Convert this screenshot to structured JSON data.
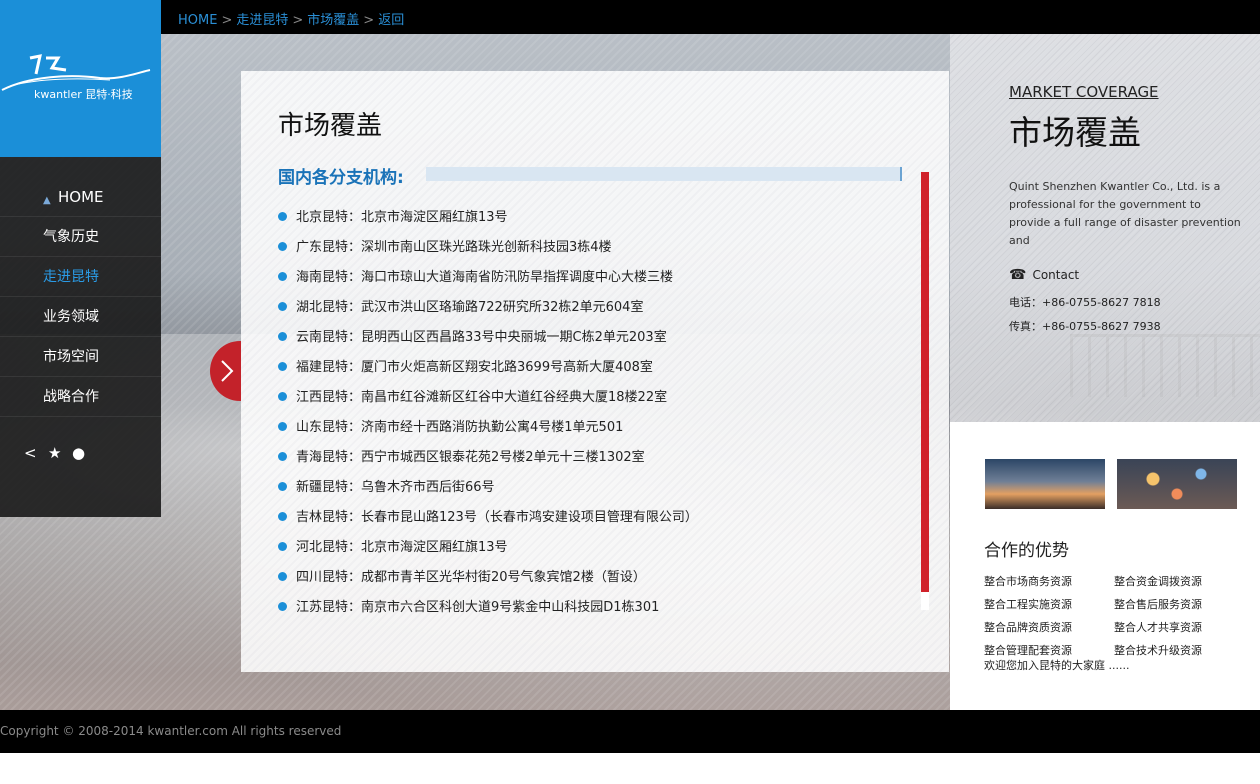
{
  "breadcrumb": {
    "items": [
      "HOME",
      "走进昆特",
      "市场覆盖",
      "返回"
    ],
    "separator": ">"
  },
  "logo": {
    "text": "kwantler 昆特·科技"
  },
  "sidebar": {
    "items": [
      {
        "label": "HOME",
        "icon": "home-icon"
      },
      {
        "label": "气象历史"
      },
      {
        "label": "走进昆特",
        "active": true
      },
      {
        "label": "业务领域"
      },
      {
        "label": "市场空间"
      },
      {
        "label": "战略合作"
      }
    ],
    "social_icons": [
      "share-icon",
      "star-icon",
      "wechat-icon"
    ]
  },
  "main": {
    "title": "市场覆盖",
    "section_heading": "国内各分支机构:",
    "branches": [
      "北京昆特：北京市海淀区厢红旗13号",
      "广东昆特：深圳市南山区珠光路珠光创新科技园3栋4楼",
      "海南昆特：海口市琼山大道海南省防汛防旱指挥调度中心大楼三楼",
      "湖北昆特：武汉市洪山区珞瑜路722研究所32栋2单元604室",
      "云南昆特：昆明西山区西昌路33号中央丽城一期C栋2单元203室",
      "福建昆特：厦门市火炬高新区翔安北路3699号高新大厦408室",
      "江西昆特：南昌市红谷滩新区红谷中大道红谷经典大厦18楼22室",
      "山东昆特：济南市经十西路消防执勤公寓4号楼1单元501",
      "青海昆特：西宁市城西区银泰花苑2号楼2单元十三楼1302室",
      "新疆昆特：乌鲁木齐市西后街66号",
      "吉林昆特：长春市昆山路123号（长春市鸿安建设项目管理有限公司）",
      "河北昆特：北京市海淀区厢红旗13号",
      "四川昆特：成都市青羊区光华村街20号气象宾馆2楼（暂设）",
      "江苏昆特：南京市六合区科创大道9号紫金中山科技园D1栋301"
    ]
  },
  "right_panel": {
    "heading_en": "MARKET COVERAGE",
    "heading_cn": "市场覆盖",
    "about": "Quint Shenzhen Kwantler Co., Ltd. is a professional for the government to provide a full range of disaster prevention and",
    "contact_label": "Contact",
    "tel": "电话：+86-0755-8627 7818",
    "fax": "传真：+86-0755-8627 7938",
    "advantages_title": "合作的优势",
    "advantages": [
      "整合市场商务资源",
      "整合资金调拨资源",
      "整合工程实施资源",
      "整合售后服务资源",
      "整合品牌资质资源",
      "整合人才共享资源",
      "整合管理配套资源",
      "整合技术升级资源"
    ],
    "welcome": "欢迎您加入昆特的大家庭 ......"
  },
  "footer": {
    "copyright": "Copyright © 2008-2014 kwantler.com All rights reserved"
  },
  "colors": {
    "brand_blue": "#1b8fd8",
    "accent_red": "#c3222a",
    "nav_bg": "#141414"
  }
}
